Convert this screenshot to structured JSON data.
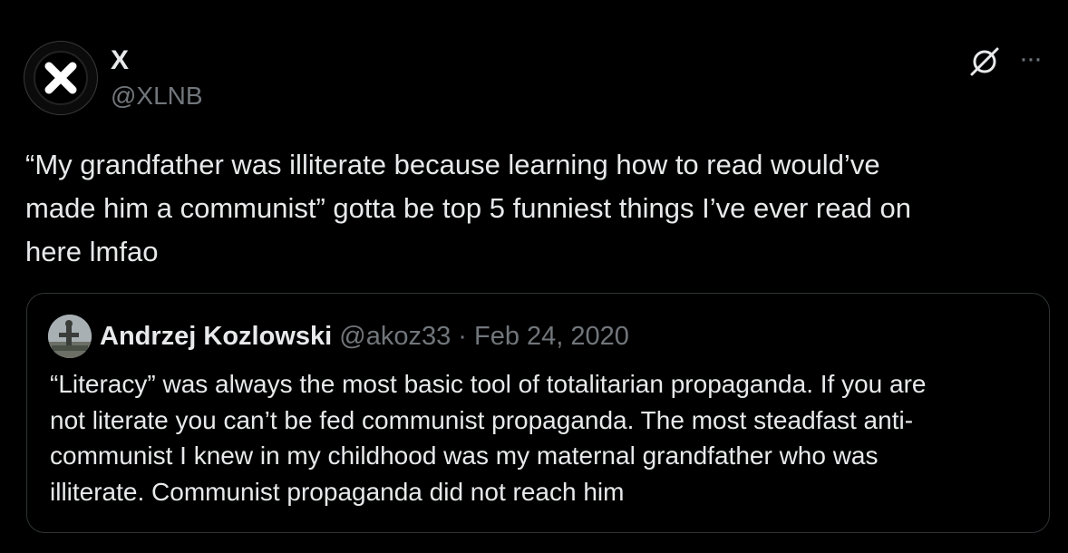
{
  "tweet": {
    "author": {
      "display_name": "X",
      "handle": "@XLNB"
    },
    "text": "“My grandfather was illiterate because learning how to read  would’ve\nmade him a communist” gotta be top 5 funniest things I’ve ever read on\nhere lmfao",
    "actions": {
      "grok_icon": "grok-icon",
      "more_icon": "more-options-icon",
      "more_glyph": "···"
    }
  },
  "quoted_tweet": {
    "display_name": "Andrzej Kozlowski",
    "handle": "@akoz33",
    "separator": "·",
    "date": "Feb 24, 2020",
    "text": "“Literacy” was always the most basic tool of totalitarian propaganda. If you are\nnot literate you can’t be fed communist propaganda. The most steadfast anti-\ncommunist I knew in my childhood was my maternal grandfather who was\nilliterate. Communist propaganda did not reach him"
  },
  "colors": {
    "background": "#000000",
    "primary_text": "#e7e9ea",
    "secondary_text": "#71767b",
    "border": "#2f3336"
  }
}
